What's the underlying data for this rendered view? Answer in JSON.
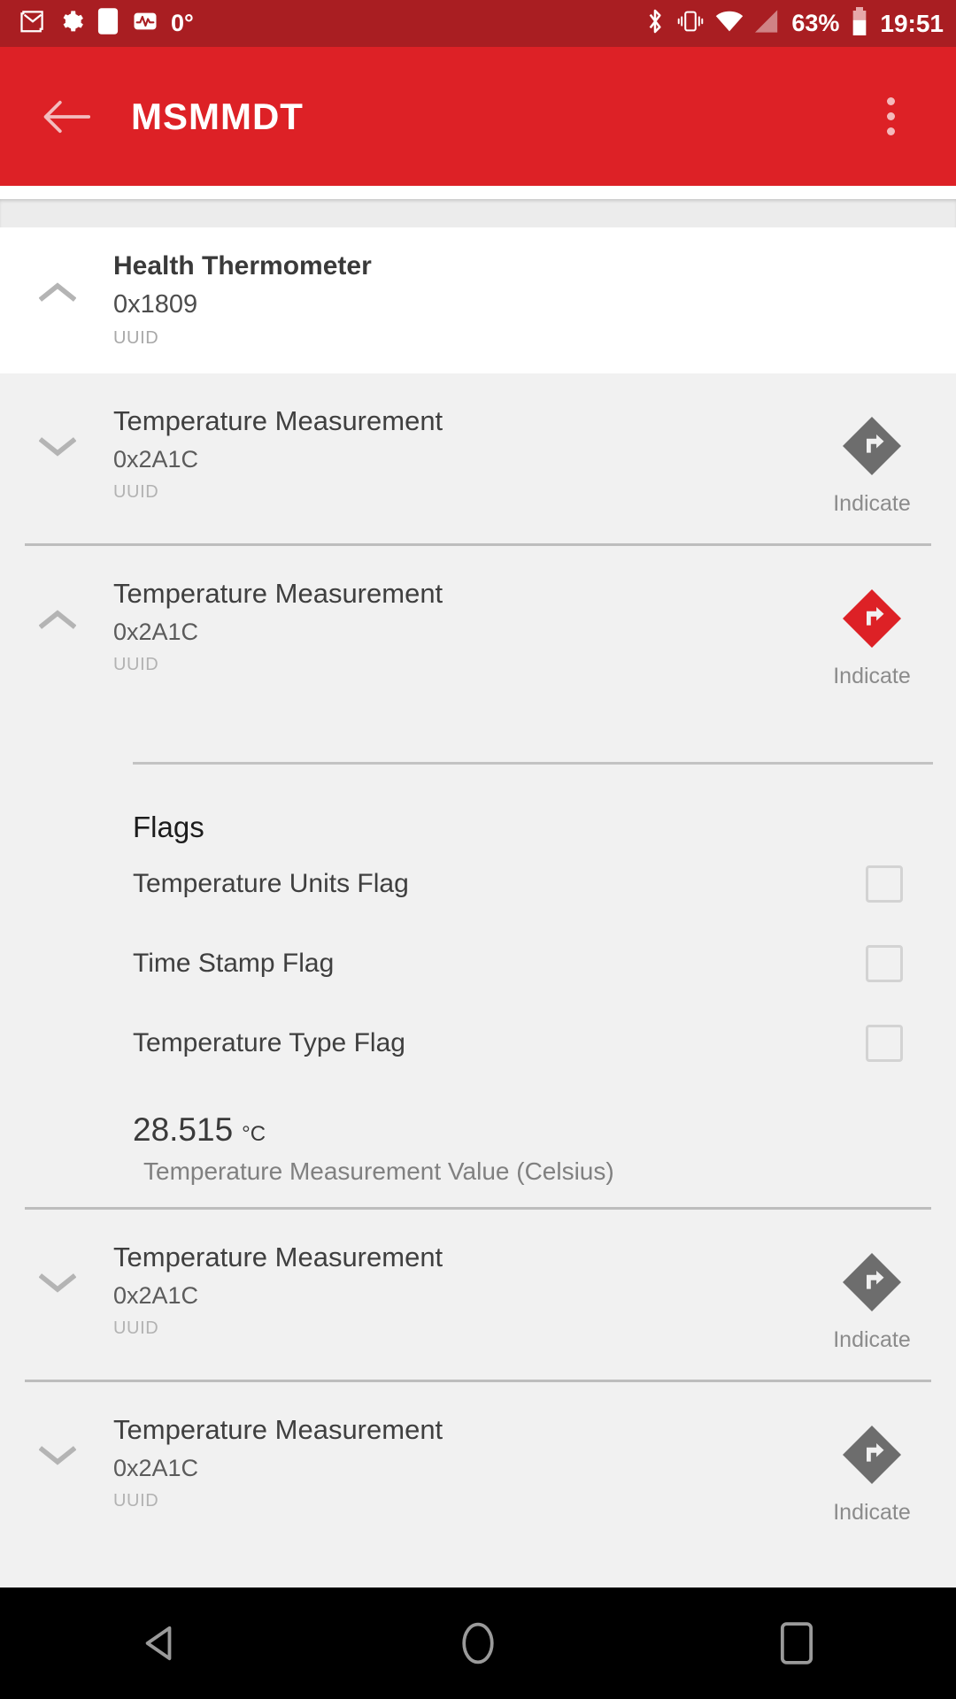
{
  "statusbar": {
    "icons_left": [
      "gmail-icon",
      "settings-icon",
      "blank-notification-icon",
      "activity-monitor-icon"
    ],
    "temperature": "0°",
    "icons_right": [
      "bluetooth-icon",
      "vibrate-icon",
      "wifi-icon",
      "cellular-signal-icon"
    ],
    "battery_percent": "63%",
    "battery_icon": "battery-icon",
    "clock": "19:51"
  },
  "appbar": {
    "back_icon": "back-arrow-icon",
    "title": "MSMMDT",
    "overflow_icon": "overflow-menu-icon"
  },
  "service": {
    "name": "Health Thermometer",
    "uuid": "0x1809",
    "uuid_caption": "UUID",
    "expand_icon": "chevron-up-icon",
    "expanded": true
  },
  "characteristics": [
    {
      "name": "Temperature Measurement",
      "uuid": "0x2A1C",
      "uuid_caption": "UUID",
      "property_label": "Indicate",
      "property_icon": "indicate-arrow-icon",
      "property_color": "#6d6d6d",
      "expand_icon": "chevron-down-icon",
      "expanded": false
    },
    {
      "name": "Temperature Measurement",
      "uuid": "0x2A1C",
      "uuid_caption": "UUID",
      "property_label": "Indicate",
      "property_icon": "indicate-arrow-icon",
      "property_color": "#dd2126",
      "expand_icon": "chevron-up-icon",
      "expanded": true
    },
    {
      "name": "Temperature Measurement",
      "uuid": "0x2A1C",
      "uuid_caption": "UUID",
      "property_label": "Indicate",
      "property_icon": "indicate-arrow-icon",
      "property_color": "#6d6d6d",
      "expand_icon": "chevron-down-icon",
      "expanded": false
    },
    {
      "name": "Temperature Measurement",
      "uuid": "0x2A1C",
      "uuid_caption": "UUID",
      "property_label": "Indicate",
      "property_icon": "indicate-arrow-icon",
      "property_color": "#6d6d6d",
      "expand_icon": "chevron-down-icon",
      "expanded": false
    }
  ],
  "detail": {
    "flags_heading": "Flags",
    "flags": [
      {
        "label": "Temperature Units Flag",
        "checked": false
      },
      {
        "label": "Time Stamp Flag",
        "checked": false
      },
      {
        "label": "Temperature Type Flag",
        "checked": false
      }
    ],
    "value": "28.515",
    "unit": "°C",
    "value_caption": "Temperature Measurement Value (Celsius)"
  },
  "navbar": {
    "back": "nav-back-icon",
    "home": "nav-home-icon",
    "recents": "nav-recents-icon"
  },
  "colors": {
    "status_bar": "#a91e22",
    "app_bar": "#dd2126",
    "accent": "#dd2126",
    "list_bg": "#f1f1f1",
    "card_bg": "#ffffff"
  }
}
